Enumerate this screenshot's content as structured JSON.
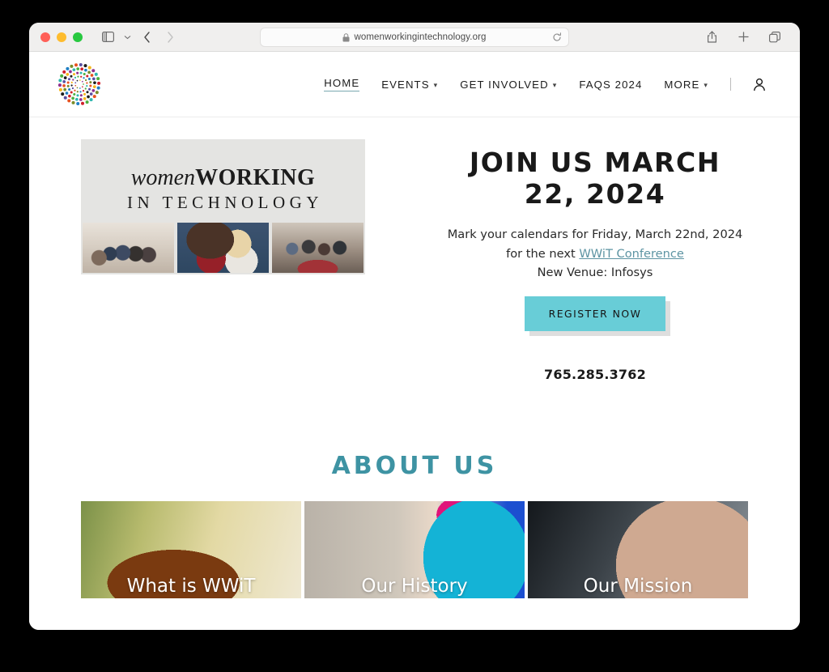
{
  "browser": {
    "url": "womenworkingintechnology.org",
    "icons": {
      "sidebar": "sidebar-icon",
      "tab_overview_caret": "chevron-down-icon",
      "back": "back-arrow-icon",
      "forward": "forward-arrow-icon",
      "lock": "lock-icon",
      "reload": "reload-icon",
      "share": "share-icon",
      "new_tab": "plus-icon",
      "tabs": "tabs-icon"
    }
  },
  "site": {
    "logo_name": "wwit-circular-dot-logo",
    "nav": [
      {
        "label": "HOME",
        "has_caret": false,
        "active": true
      },
      {
        "label": "EVENTS",
        "has_caret": true,
        "active": false
      },
      {
        "label": "GET INVOLVED",
        "has_caret": true,
        "active": false
      },
      {
        "label": "FAQS 2024",
        "has_caret": false,
        "active": false
      },
      {
        "label": "MORE",
        "has_caret": true,
        "active": false
      }
    ],
    "account_icon": "person-icon"
  },
  "banner": {
    "word_italic": "women",
    "word_bold": "WORKING",
    "line2": "IN TECHNOLOGY",
    "photos": [
      "group-photo-hallway",
      "two-women-portrait",
      "banquet-room-attendees"
    ]
  },
  "hero": {
    "title": "JOIN US MARCH 22, 2024",
    "body_part1": "Mark your calendars for Friday, March 22nd, 2024 for the next ",
    "link_text": "WWiT Conference",
    "venue": "New Venue:  Infosys",
    "register_label": "REGISTER NOW",
    "phone": "765.285.3762",
    "register_color": "#68cdd7"
  },
  "about": {
    "title": "ABOUT US",
    "accent_color": "#3e93a3",
    "cards": [
      {
        "label": "What is WWiT"
      },
      {
        "label": "Our History"
      },
      {
        "label": "Our Mission"
      }
    ]
  }
}
